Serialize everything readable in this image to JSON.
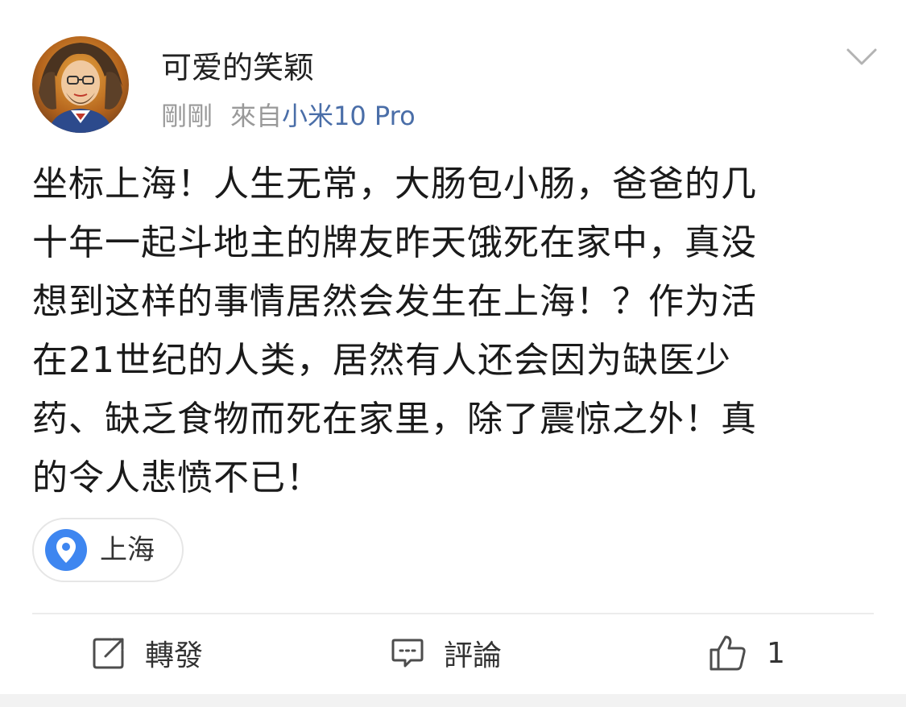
{
  "post": {
    "author": "可爱的笑颖",
    "time": "剛剛",
    "source_prefix": "來自",
    "device": "小米10 Pro",
    "text_lines": [
      "坐标上海！人生无常，大肠包小肠，爸爸的几",
      "十年一起斗地主的牌友昨天饿死在家中，真没",
      "想到这样的事情居然会发生在上海！？作为活",
      "在21世纪的人类，居然有人还会因为缺医少",
      "药、缺乏食物而死在家里，除了震惊之外！真",
      "的令人悲愤不已！"
    ],
    "location": "上海"
  },
  "actions": {
    "repost_label": "轉發",
    "comment_label": "評論",
    "like_count": "1"
  },
  "icons": {
    "menu": "chevron-down-icon",
    "location": "location-pin-icon",
    "repost": "share-icon",
    "comment": "comment-icon",
    "like": "thumbs-up-icon"
  },
  "colors": {
    "device_link": "#4a6ea8",
    "location_pin": "#3e86f0",
    "meta_text": "#999999"
  }
}
